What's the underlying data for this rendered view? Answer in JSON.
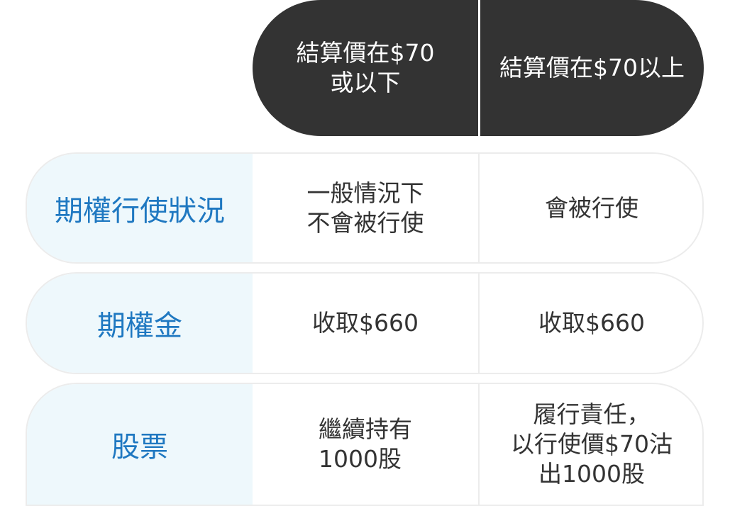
{
  "header": {
    "col1": "結算價在$70\n或以下",
    "col2": "結算價在$70以上"
  },
  "rows": [
    {
      "label": "期權行使狀況",
      "col1": "一般情況下\n不會被行使",
      "col2": "會被行使"
    },
    {
      "label": "期權金",
      "col1": "收取$660",
      "col2": "收取$660"
    },
    {
      "label": "股票",
      "col1": "繼續持有\n1000股",
      "col2": "履行責任，\n以行使價$70沽\n出1000股"
    }
  ],
  "colors": {
    "header_bg": "#333333",
    "label_bg": "#eef8fc",
    "label_text": "#1f78c1",
    "body_text": "#333333",
    "border": "#ececec"
  }
}
